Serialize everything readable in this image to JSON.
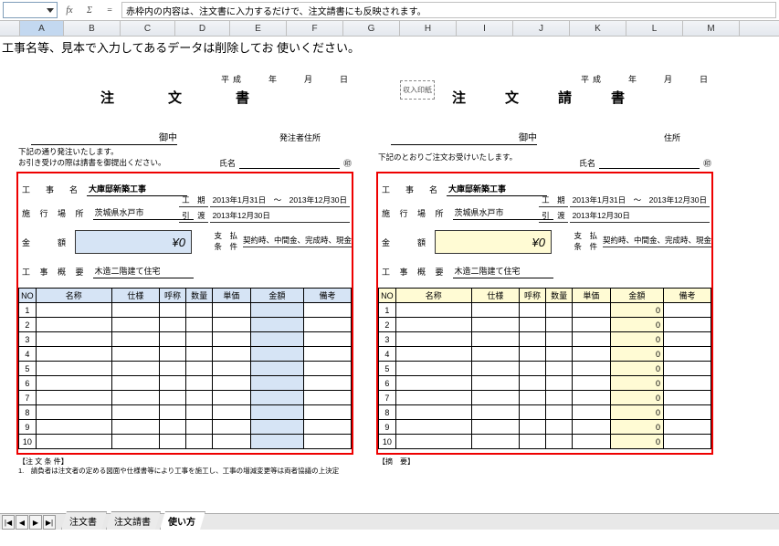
{
  "formulabar": {
    "fx": "fx",
    "sigma": "Σ",
    "eq": "=",
    "text": "赤枠内の内容は、注文書に入力するだけで、注文請書にも反映されます。"
  },
  "columns": [
    "A",
    "B",
    "C",
    "D",
    "E",
    "F",
    "G",
    "H",
    "I",
    "J",
    "K",
    "L",
    "M"
  ],
  "sheet_note": "工事名等、見本で入力してあるデータは削除してお 使いください。",
  "tabs": {
    "nav": [
      "|◀",
      "◀",
      "▶",
      "▶|"
    ],
    "items": [
      "注文書",
      "注文請書",
      "使い方"
    ],
    "active": 2
  },
  "order": {
    "heisei": "平成　　年　　月　　日",
    "title": "注　文　書",
    "onchu": "御中",
    "addr_label": "発注者住所",
    "notes": [
      "下記の通り発注いたします。",
      "お引き受けの際は請書を御提出ください。"
    ],
    "shimei": "氏名",
    "fields": {
      "kouji_label": "工　事　名",
      "kouji": "大庫邸新築工事",
      "basho_label": "施 行 場 所",
      "basho": "茨城県水戸市",
      "kingaku_label": "金　　額",
      "kingaku": "¥0",
      "gaiyo_label": "工 事 概 要",
      "gaiyo": "木造二階建て住宅",
      "kouki_label": "工　期",
      "kouki": "2013年1月31日　～　2013年12月30日",
      "hikiwatashi_label": "引　渡",
      "hikiwatashi": "2013年12月30日",
      "shiharai_label": "支　払\n条　件",
      "shiharai": "契約時、中間金、完成時、現金"
    },
    "grid": {
      "headers": [
        "NO",
        "名称",
        "仕様",
        "呼称",
        "数量",
        "単価",
        "金額",
        "備考"
      ],
      "rows": [
        1,
        2,
        3,
        4,
        5,
        6,
        7,
        8,
        9,
        10
      ]
    },
    "footer_box": "【注 文 条 件】",
    "footer_text": "1.　請負者は注文者の定める図面や仕様書等により工事を施工し、工事の増減変更等は両者協議の上決定"
  },
  "receipt": {
    "heisei": "平成　　年　　月　　日",
    "title": "注　文　請　書",
    "stamp": "収入印紙",
    "onchu": "御中",
    "addr_label": "住所",
    "notes": [
      "下記のとおりご注文お受けいたします。"
    ],
    "shimei": "氏名",
    "fields": {
      "kouji_label": "工　事　名",
      "kouji": "大庫邸新築工事",
      "basho_label": "施 行 場 所",
      "basho": "茨城県水戸市",
      "kingaku_label": "金　　額",
      "kingaku": "¥0",
      "gaiyo_label": "工 事 概 要",
      "gaiyo": "木造二階建て住宅",
      "kouki_label": "工　期",
      "kouki": "2013年1月31日　～　2013年12月30日",
      "hikiwatashi_label": "引　渡",
      "hikiwatashi": "2013年12月30日",
      "shiharai_label": "支　払\n条　件",
      "shiharai": "契約時、中間金、完成時、現金"
    },
    "grid": {
      "headers": [
        "NO",
        "名称",
        "仕様",
        "呼称",
        "数量",
        "単価",
        "金額",
        "備考"
      ],
      "rows": [
        1,
        2,
        3,
        4,
        5,
        6,
        7,
        8,
        9,
        10
      ],
      "amount_zero": "0"
    },
    "footer_box": "【摘　要】"
  }
}
